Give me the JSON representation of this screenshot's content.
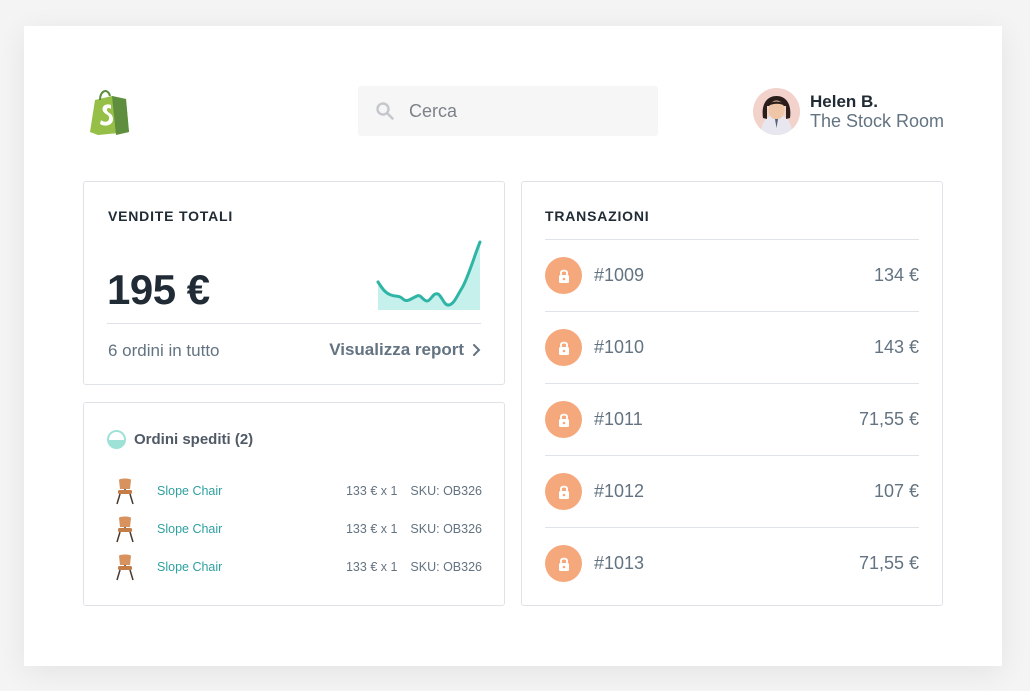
{
  "header": {
    "logo": "shopify-bag-logo",
    "search": {
      "placeholder": "Cerca"
    },
    "user": {
      "name": "Helen B.",
      "store": "The Stock Room"
    }
  },
  "sales_card": {
    "title": "VENDITE TOTALI",
    "total": "195 €",
    "orders_text": "6 ordini in tutto",
    "report_link": "Visualizza report",
    "sparkline_color": "#2fb5a5",
    "sparkline_fill": "#c5f0ec"
  },
  "shipped_card": {
    "title": "Ordini spediti (2)",
    "items": [
      {
        "name": "Slope Chair",
        "qty": "133 € x 1",
        "sku": "SKU: OB326"
      },
      {
        "name": "Slope Chair",
        "qty": "133 € x 1",
        "sku": "SKU: OB326"
      },
      {
        "name": "Slope Chair",
        "qty": "133 € x 1",
        "sku": "SKU: OB326"
      }
    ]
  },
  "transactions_card": {
    "title": "TRANSAZIONI",
    "rows": [
      {
        "id": "#1009",
        "amount": "134 €"
      },
      {
        "id": "#1010",
        "amount": "143 €"
      },
      {
        "id": "#1011",
        "amount": "71,55 €"
      },
      {
        "id": "#1012",
        "amount": "107 €"
      },
      {
        "id": "#1013",
        "amount": "71,55 €"
      }
    ]
  },
  "colors": {
    "shopify_green": "#95bf47",
    "lock_orange": "#f6a87d",
    "teal_link": "#2fa0a1"
  }
}
